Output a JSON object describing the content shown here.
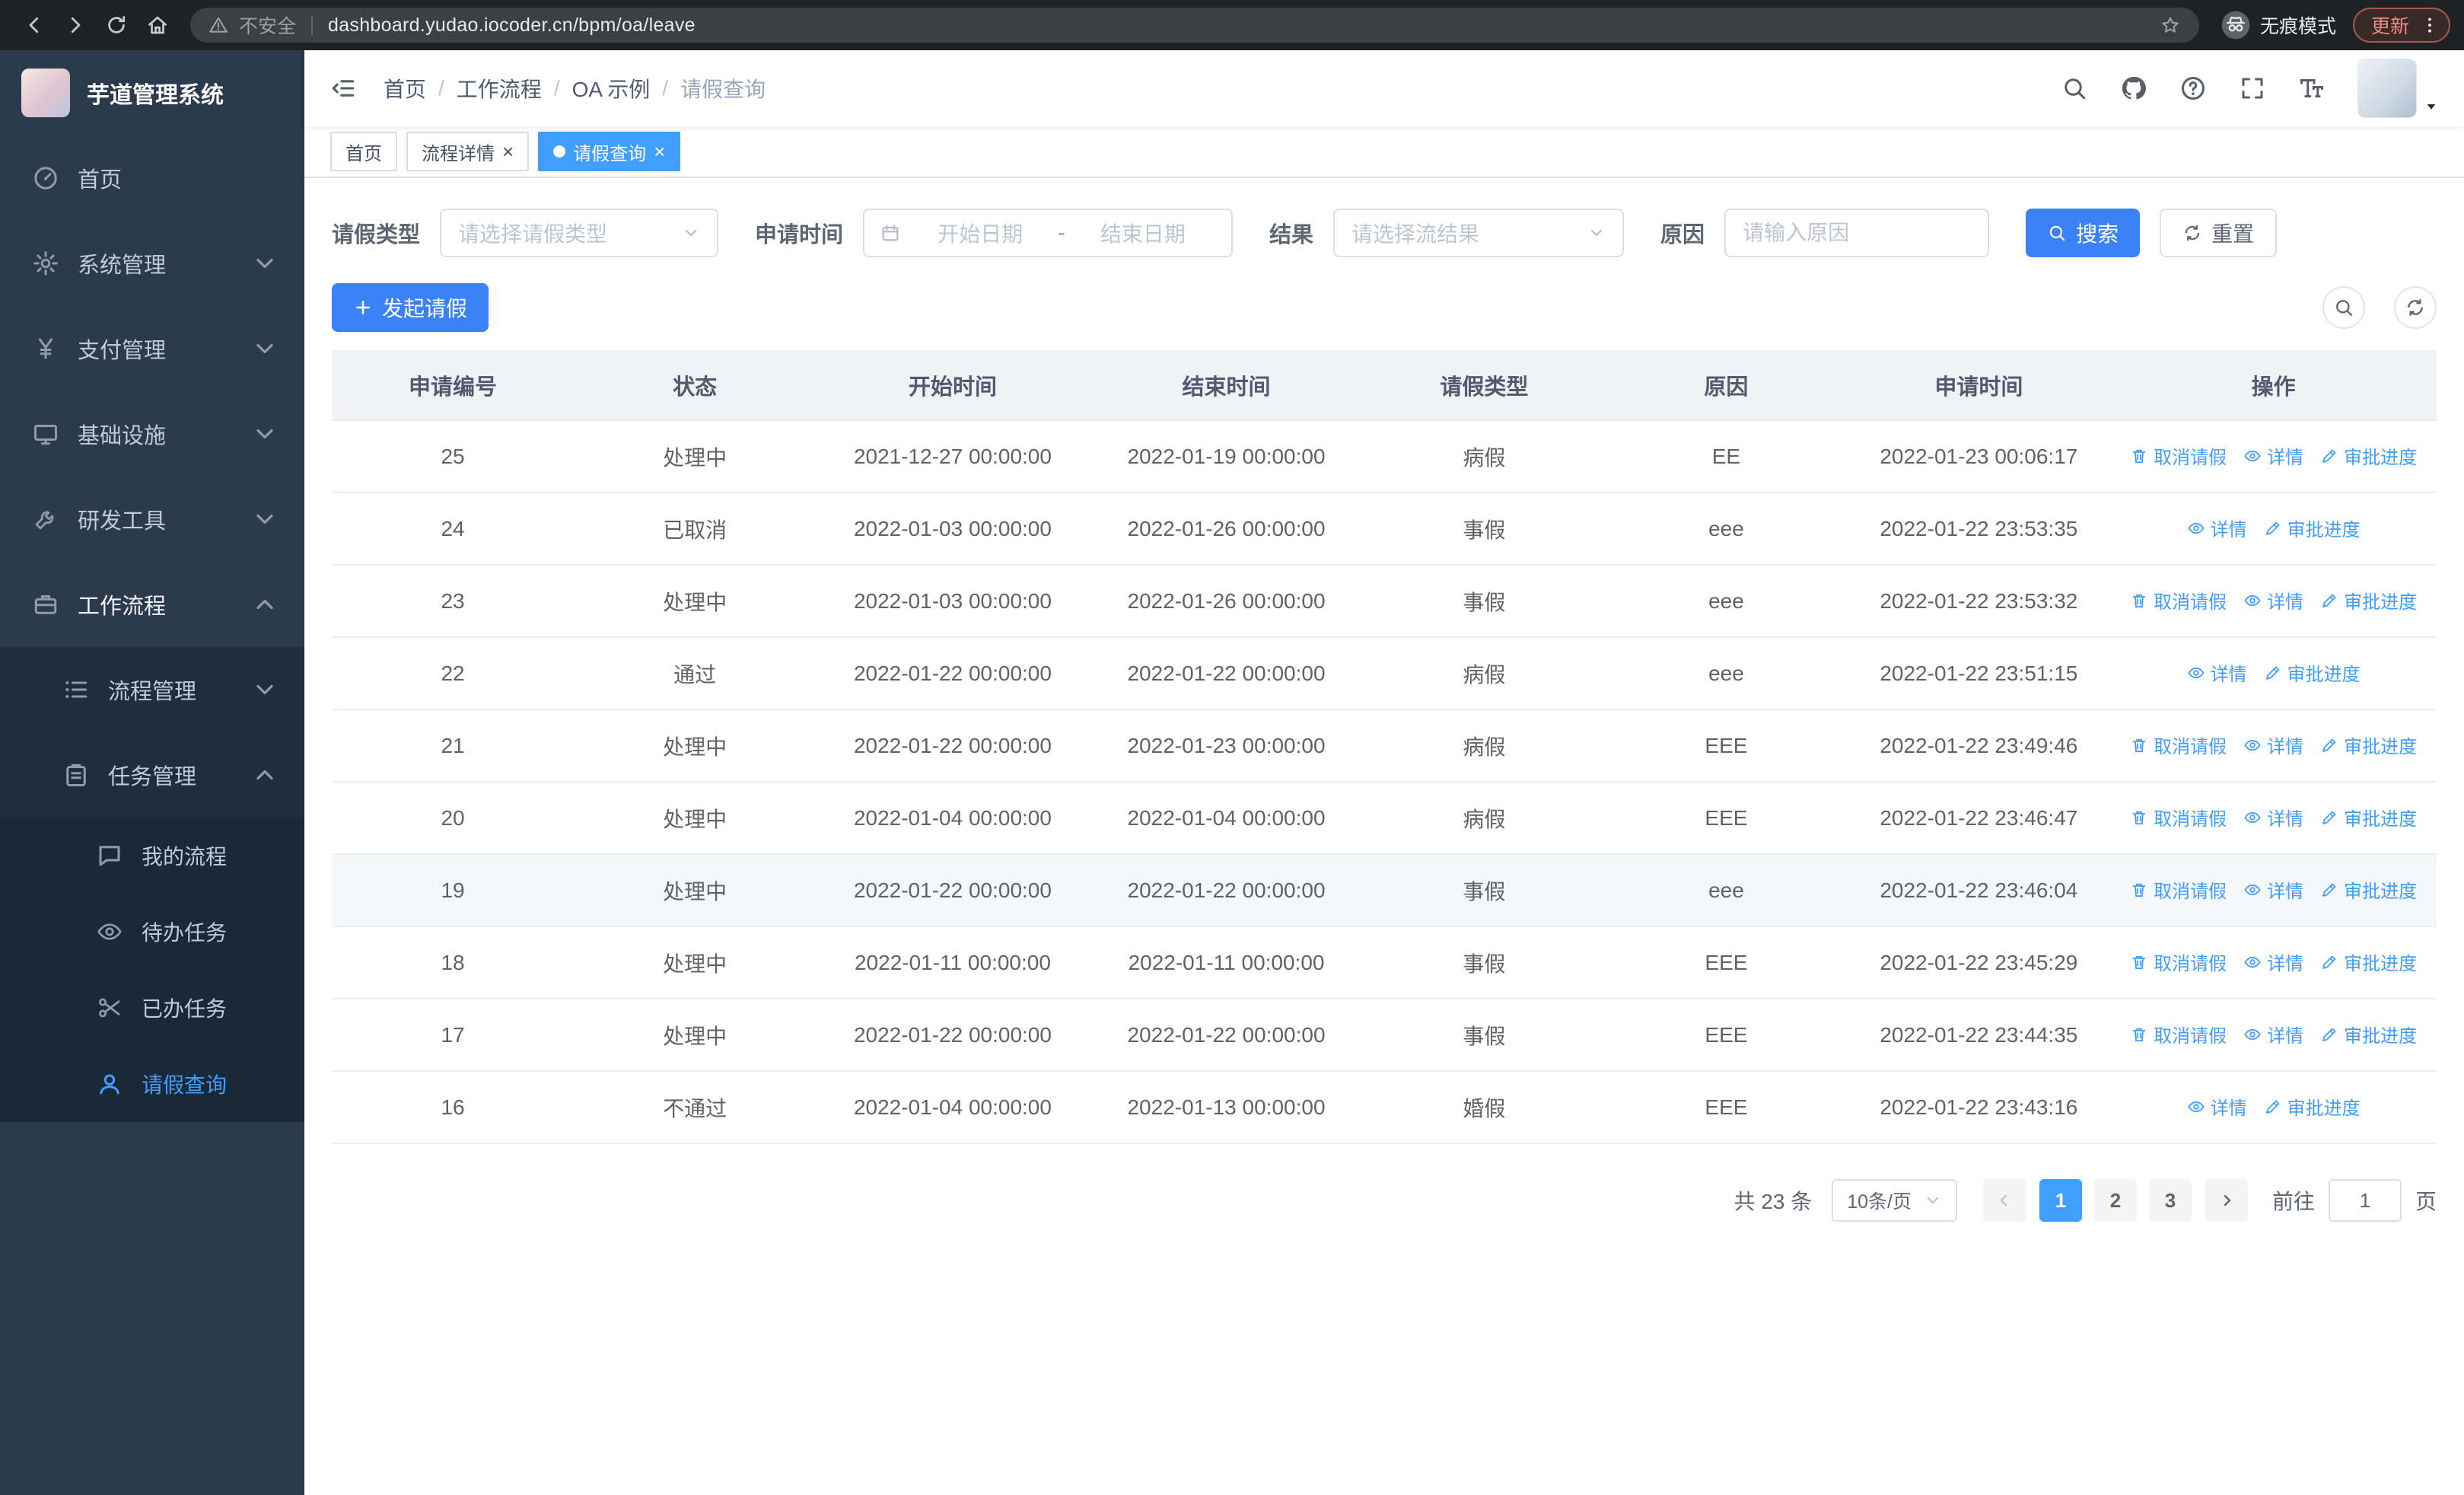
{
  "colors": {
    "accent": "#409eff",
    "button_blue": "#3b82f6",
    "sidebar_bg": "#2b3a4d",
    "sidebar_sub_bg": "#1f2d3d",
    "sidebar_subsub_bg": "#1b2836",
    "chrome_bg": "#202124",
    "table_header_bg": "#f0f2f6"
  },
  "browser": {
    "security_label": "不安全",
    "url": "dashboard.yudao.iocoder.cn/bpm/oa/leave",
    "incognito_label": "无痕模式",
    "update_label": "更新"
  },
  "sidebar": {
    "title": "芋道管理系统",
    "items": [
      {
        "key": "home",
        "label": "首页",
        "icon": "dashboard",
        "level": 1
      },
      {
        "key": "system-management",
        "label": "系统管理",
        "icon": "gear",
        "level": 1,
        "chevron": "down"
      },
      {
        "key": "payment-management",
        "label": "支付管理",
        "icon": "yen",
        "level": 1,
        "chevron": "down"
      },
      {
        "key": "infrastructure",
        "label": "基础设施",
        "icon": "monitor",
        "level": 1,
        "chevron": "down"
      },
      {
        "key": "dev-tools",
        "label": "研发工具",
        "icon": "wrench",
        "level": 1,
        "chevron": "down"
      },
      {
        "key": "workflow",
        "label": "工作流程",
        "icon": "suitcase",
        "level": 1,
        "chevron": "up",
        "open": true
      },
      {
        "key": "process-management",
        "label": "流程管理",
        "icon": "list",
        "level": 2,
        "chevron": "down"
      },
      {
        "key": "task-management",
        "label": "任务管理",
        "icon": "clipboard",
        "level": 2,
        "chevron": "up"
      },
      {
        "key": "my-processes",
        "label": "我的流程",
        "icon": "chat",
        "level": 3
      },
      {
        "key": "todo-tasks",
        "label": "待办任务",
        "icon": "eye",
        "level": 3
      },
      {
        "key": "done-tasks",
        "label": "已办任务",
        "icon": "scissors",
        "level": 3
      },
      {
        "key": "leave-query",
        "label": "请假查询",
        "icon": "user",
        "level": 3,
        "active": true
      }
    ]
  },
  "header": {
    "breadcrumb": [
      "首页",
      "工作流程",
      "OA 示例",
      "请假查询"
    ]
  },
  "tabs": [
    {
      "label": "首页",
      "closable": false,
      "active": false
    },
    {
      "label": "流程详情",
      "closable": true,
      "active": false
    },
    {
      "label": "请假查询",
      "closable": true,
      "active": true
    }
  ],
  "filters": {
    "leave_type_label": "请假类型",
    "leave_type_placeholder": "请选择请假类型",
    "apply_time_label": "申请时间",
    "start_date_placeholder": "开始日期",
    "date_separator": "-",
    "end_date_placeholder": "结束日期",
    "result_label": "结果",
    "result_placeholder": "请选择流结果",
    "reason_label": "原因",
    "reason_placeholder": "请输入原因",
    "search_button": "搜索",
    "reset_button": "重置"
  },
  "toolbar": {
    "create_button": "发起请假"
  },
  "table": {
    "columns": [
      "申请编号",
      "状态",
      "开始时间",
      "结束时间",
      "请假类型",
      "原因",
      "申请时间",
      "操作"
    ],
    "column_keys": [
      "id",
      "status",
      "start",
      "end",
      "type",
      "reason",
      "apply-time",
      "operations"
    ],
    "action_defs": {
      "cancel": {
        "label": "取消请假",
        "icon": "trash"
      },
      "detail": {
        "label": "详情",
        "icon": "eye"
      },
      "progress": {
        "label": "审批进度",
        "icon": "pen"
      }
    },
    "rows": [
      {
        "id": "25",
        "status": "处理中",
        "start": "2021-12-27 00:00:00",
        "end": "2022-01-19 00:00:00",
        "type": "病假",
        "reason": "EE",
        "apply_time": "2022-01-23 00:06:17",
        "actions": [
          "cancel",
          "detail",
          "progress"
        ],
        "highlight": false
      },
      {
        "id": "24",
        "status": "已取消",
        "start": "2022-01-03 00:00:00",
        "end": "2022-01-26 00:00:00",
        "type": "事假",
        "reason": "eee",
        "apply_time": "2022-01-22 23:53:35",
        "actions": [
          "detail",
          "progress"
        ],
        "highlight": false
      },
      {
        "id": "23",
        "status": "处理中",
        "start": "2022-01-03 00:00:00",
        "end": "2022-01-26 00:00:00",
        "type": "事假",
        "reason": "eee",
        "apply_time": "2022-01-22 23:53:32",
        "actions": [
          "cancel",
          "detail",
          "progress"
        ],
        "highlight": false
      },
      {
        "id": "22",
        "status": "通过",
        "start": "2022-01-22 00:00:00",
        "end": "2022-01-22 00:00:00",
        "type": "病假",
        "reason": "eee",
        "apply_time": "2022-01-22 23:51:15",
        "actions": [
          "detail",
          "progress"
        ],
        "highlight": false
      },
      {
        "id": "21",
        "status": "处理中",
        "start": "2022-01-22 00:00:00",
        "end": "2022-01-23 00:00:00",
        "type": "病假",
        "reason": "EEE",
        "apply_time": "2022-01-22 23:49:46",
        "actions": [
          "cancel",
          "detail",
          "progress"
        ],
        "highlight": false
      },
      {
        "id": "20",
        "status": "处理中",
        "start": "2022-01-04 00:00:00",
        "end": "2022-01-04 00:00:00",
        "type": "病假",
        "reason": "EEE",
        "apply_time": "2022-01-22 23:46:47",
        "actions": [
          "cancel",
          "detail",
          "progress"
        ],
        "highlight": false
      },
      {
        "id": "19",
        "status": "处理中",
        "start": "2022-01-22 00:00:00",
        "end": "2022-01-22 00:00:00",
        "type": "事假",
        "reason": "eee",
        "apply_time": "2022-01-22 23:46:04",
        "actions": [
          "cancel",
          "detail",
          "progress"
        ],
        "highlight": true
      },
      {
        "id": "18",
        "status": "处理中",
        "start": "2022-01-11 00:00:00",
        "end": "2022-01-11 00:00:00",
        "type": "事假",
        "reason": "EEE",
        "apply_time": "2022-01-22 23:45:29",
        "actions": [
          "cancel",
          "detail",
          "progress"
        ],
        "highlight": false
      },
      {
        "id": "17",
        "status": "处理中",
        "start": "2022-01-22 00:00:00",
        "end": "2022-01-22 00:00:00",
        "type": "事假",
        "reason": "EEE",
        "apply_time": "2022-01-22 23:44:35",
        "actions": [
          "cancel",
          "detail",
          "progress"
        ],
        "highlight": false
      },
      {
        "id": "16",
        "status": "不通过",
        "start": "2022-01-04 00:00:00",
        "end": "2022-01-13 00:00:00",
        "type": "婚假",
        "reason": "EEE",
        "apply_time": "2022-01-22 23:43:16",
        "actions": [
          "detail",
          "progress"
        ],
        "highlight": false
      }
    ]
  },
  "pagination": {
    "total": "共 23 条",
    "page_size": "10条/页",
    "pages": [
      "1",
      "2",
      "3"
    ],
    "active_page": "1",
    "goto_label": "前往",
    "goto_value": "1",
    "page_unit": "页"
  }
}
